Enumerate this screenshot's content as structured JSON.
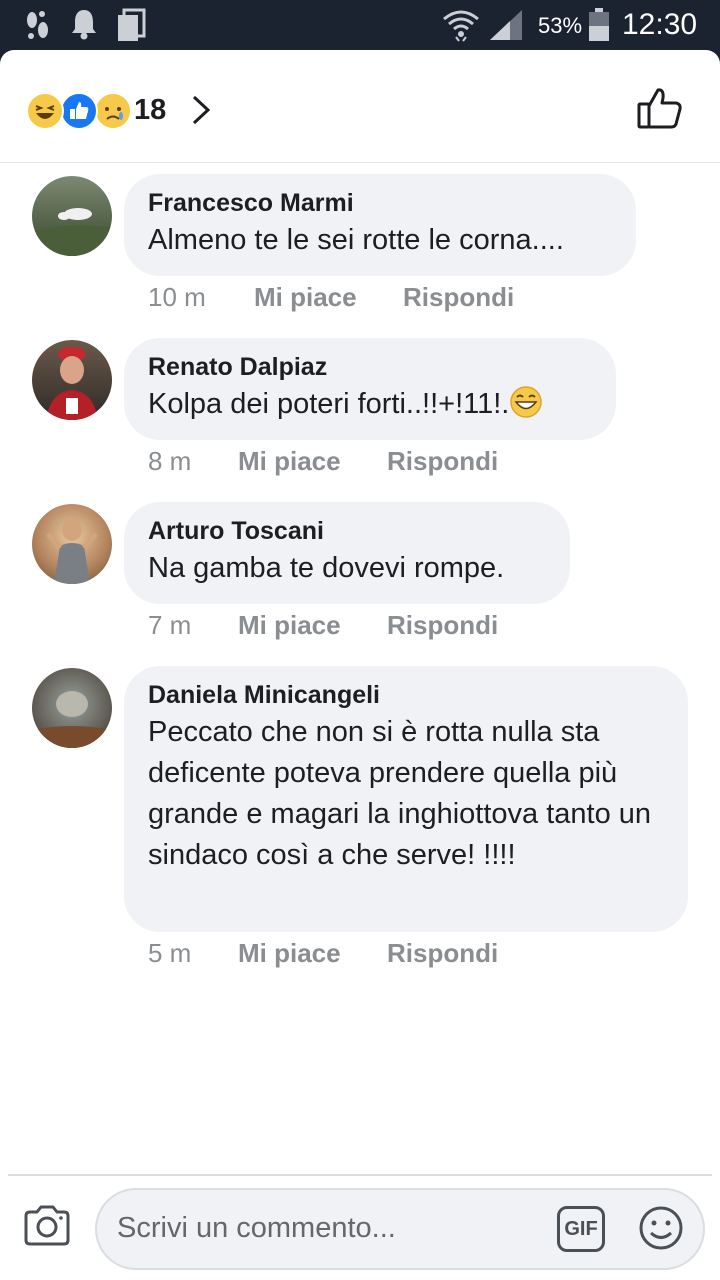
{
  "status_bar": {
    "battery": "53%",
    "time": "12:30",
    "icons": [
      "footsteps-icon",
      "bell-icon",
      "copy-icon",
      "wifi-icon",
      "signal-icon",
      "battery-icon"
    ]
  },
  "header": {
    "reaction_count": "18",
    "reactions": [
      "laugh-reaction-icon",
      "like-reaction-icon",
      "sad-reaction-icon"
    ]
  },
  "comments": [
    {
      "name": "Francesco Marmi",
      "text": "Almeno te le sei rotte le corna....",
      "time": "10 m",
      "like": "Mi piace",
      "reply": "Rispondi"
    },
    {
      "name": "Renato Dalpiaz",
      "text": "Kolpa dei poteri forti..!!+!11!.",
      "time": "8 m",
      "like": "Mi piace",
      "reply": "Rispondi"
    },
    {
      "name": "Arturo Toscani",
      "text": "Na gamba te dovevi rompe.",
      "time": "7 m",
      "like": "Mi piace",
      "reply": "Rispondi"
    },
    {
      "name": "Daniela Minicangeli",
      "text": "Peccato che non si è rotta nulla sta deficente poteva prendere quella più grande e magari la inghiottova tanto un sindaco così a che serve! !!!!",
      "time": "5 m",
      "like": "Mi piace",
      "reply": "Rispondi"
    }
  ],
  "composer": {
    "placeholder": "Scrivi un commento...",
    "gif_label": "GIF"
  },
  "colors": {
    "status_bar_bg": "#1b2230",
    "bubble_bg": "#f0f2f5",
    "meta_text": "#8a8d91",
    "like_blue": "#1877f2",
    "emoji_yellow": "#f7c948"
  }
}
